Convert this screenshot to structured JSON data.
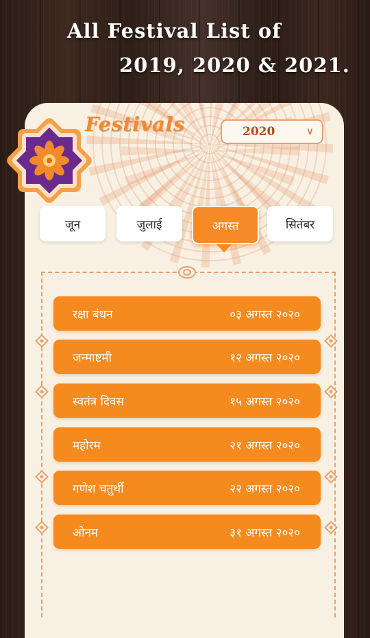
{
  "promo": {
    "line1": "All Festival List of",
    "line2": "2019, 2020 & 2021."
  },
  "app": {
    "brand": "Festivals",
    "year_selected": "2020"
  },
  "tabs": [
    {
      "label": "जून",
      "active": false
    },
    {
      "label": "जुलाई",
      "active": false
    },
    {
      "label": "अगस्त",
      "active": true
    },
    {
      "label": "सितंबर",
      "active": false
    }
  ],
  "festivals": [
    {
      "name": "रक्षा बंधन",
      "date": "०३ अगस्त २०२०"
    },
    {
      "name": "जन्माष्टमी",
      "date": "१२ अगस्त २०२०"
    },
    {
      "name": "स्वतंत्र दिवस",
      "date": "१५ अगस्त २०२०"
    },
    {
      "name": "महोरम",
      "date": "२१ अगस्त २०२०"
    },
    {
      "name": "गणेश चतुर्थी",
      "date": "२२ अगस्त २०२०"
    },
    {
      "name": "ओनम",
      "date": "३१ अगस्त २०२०"
    }
  ],
  "colors": {
    "accent": "#f58a1f",
    "brand_text": "#f08a30",
    "panel_bg": "#f8f1e3",
    "wood_bg": "#3d2920"
  }
}
